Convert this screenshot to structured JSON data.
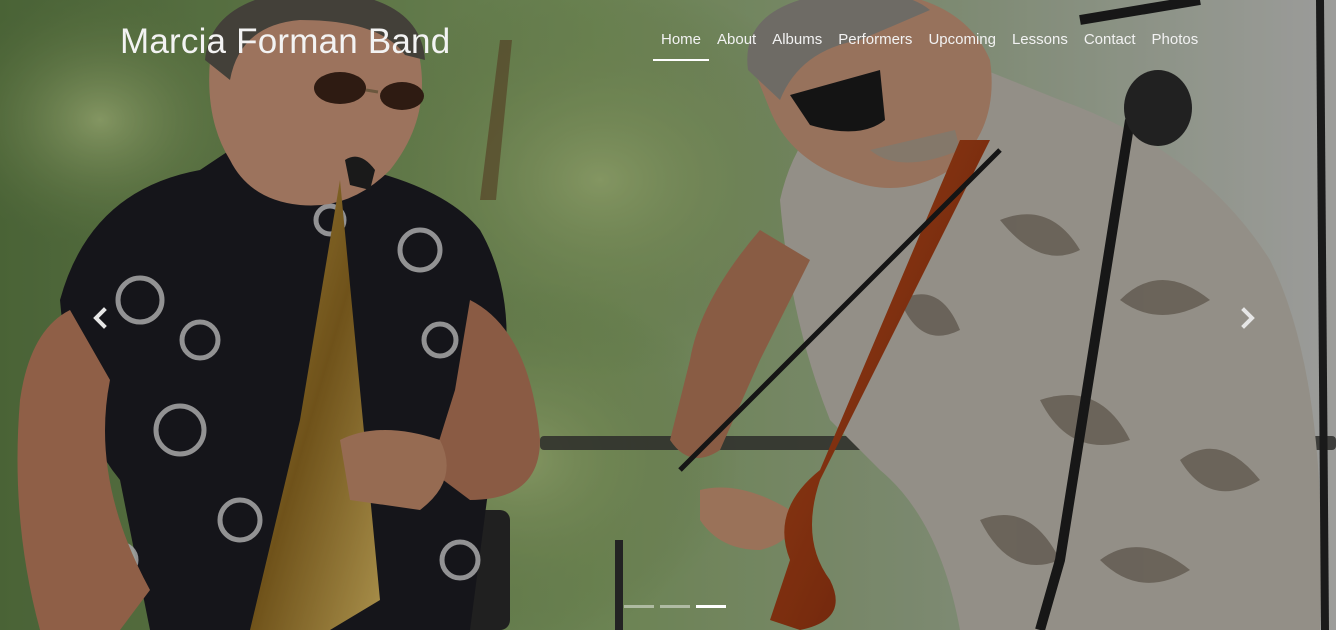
{
  "brand": {
    "name": "Marcia Forman Band"
  },
  "nav": {
    "items": [
      "Home",
      "About",
      "Albums",
      "Performers",
      "Upcoming",
      "Lessons",
      "Contact",
      "Photos"
    ],
    "active": "Home"
  },
  "carousel": {
    "slide_count": 3,
    "active_slide": 3,
    "prev_icon": "chevron-left-icon",
    "next_icon": "chevron-right-icon"
  }
}
